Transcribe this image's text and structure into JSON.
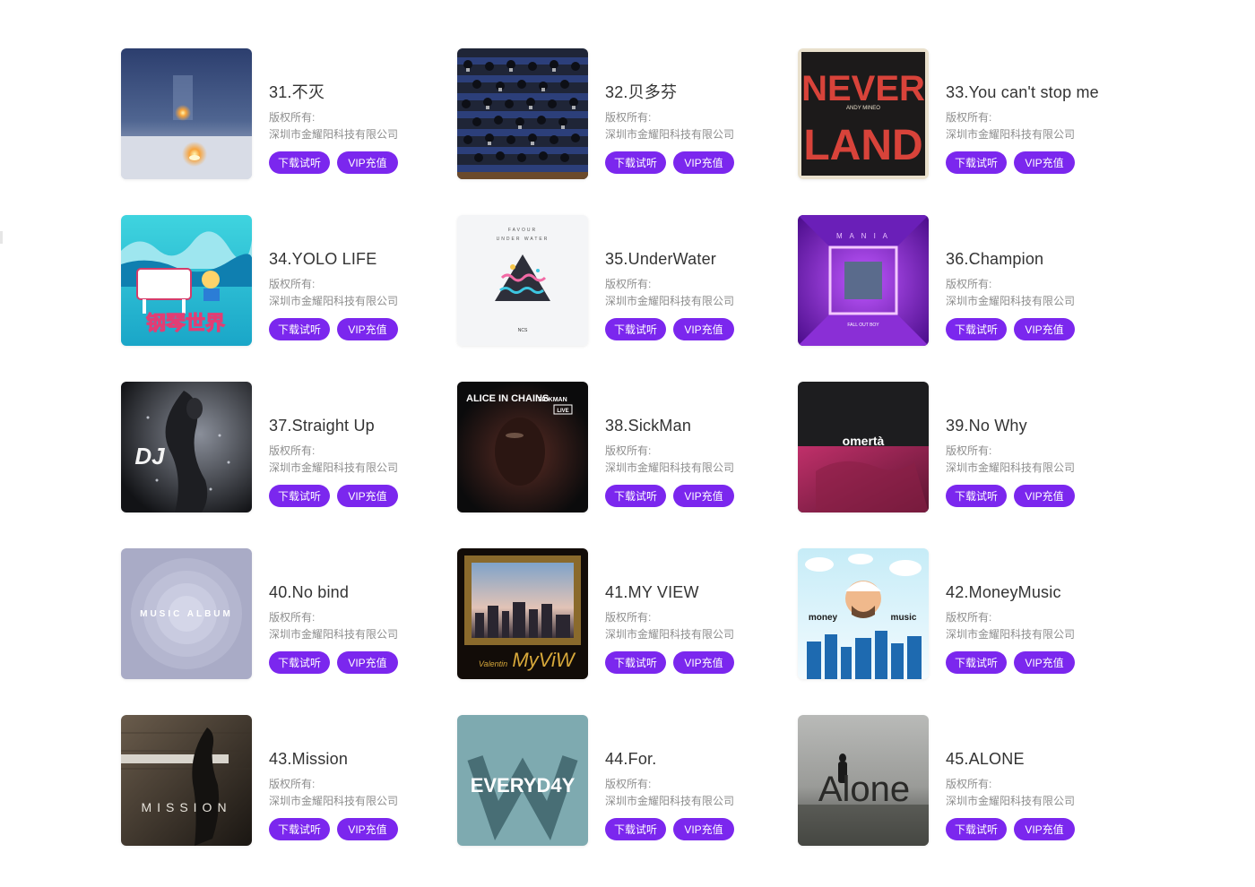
{
  "copyright_label": "版权所有:",
  "company": "深圳市金耀阳科技有限公司",
  "download_label": "下载试听",
  "vip_label": "VIP充值",
  "accent_color": "#7b27ee",
  "songs": [
    {
      "title": "31.不灭",
      "cover": "candle-cover"
    },
    {
      "title": "32.贝多芬",
      "cover": "orchestra-cover"
    },
    {
      "title": "33.You can't stop me",
      "cover": "neverland-cover",
      "cover_text": [
        "NEVER",
        "LAND",
        "ANDY MINEO"
      ]
    },
    {
      "title": "34.YOLO LIFE",
      "cover": "piano-world-cover",
      "cover_text": [
        "钢琴世界"
      ]
    },
    {
      "title": "35.UnderWater",
      "cover": "underwater-cover",
      "cover_text": [
        "FAVOUR",
        "UNDER WATER",
        "NCS"
      ]
    },
    {
      "title": "36.Champion",
      "cover": "mania-cover",
      "cover_text": [
        "M A N I A",
        "FALL OUT BOY"
      ]
    },
    {
      "title": "37.Straight Up",
      "cover": "dj-cover",
      "cover_text": [
        "DJ"
      ]
    },
    {
      "title": "38.SickMan",
      "cover": "alice-in-chains-cover",
      "cover_text": [
        "ALICE IN CHAINS",
        "SICKMAN",
        "LIVE"
      ]
    },
    {
      "title": "39.No Why",
      "cover": "omerta-cover",
      "cover_text": [
        "omertà"
      ]
    },
    {
      "title": "40.No bind",
      "cover": "music-album-cover",
      "cover_text": [
        "MUSIC ALBUM"
      ]
    },
    {
      "title": "41.MY VIEW",
      "cover": "my-view-cover",
      "cover_text": [
        "MyViW",
        "Valentin"
      ]
    },
    {
      "title": "42.MoneyMusic",
      "cover": "money-music-cover",
      "cover_text": [
        "money",
        "music"
      ]
    },
    {
      "title": "43.Mission",
      "cover": "mission-cover",
      "cover_text": [
        "MISSION"
      ]
    },
    {
      "title": "44.For.",
      "cover": "everyday-cover",
      "cover_text": [
        "EVERYD4Y"
      ]
    },
    {
      "title": "45.ALONE",
      "cover": "alone-cover",
      "cover_text": [
        "Alone"
      ]
    }
  ]
}
